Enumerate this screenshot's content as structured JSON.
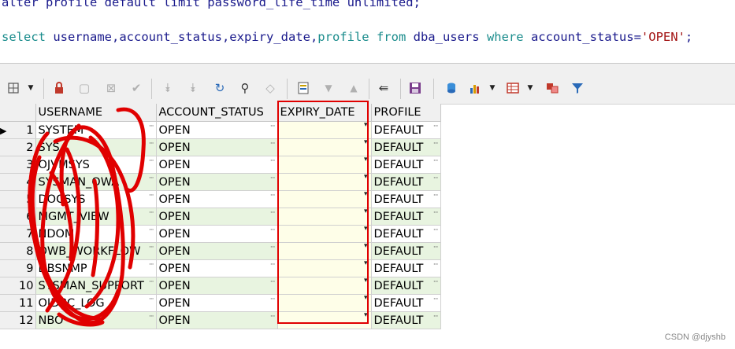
{
  "editor": {
    "line1": "alter profile default limit password_life_time unlimited;",
    "line2_parts": {
      "kw_select": "select",
      "cols": " username,account_status,expiry_date,",
      "kw_profile": "profile",
      "sp1": " ",
      "kw_from": "from",
      "table": " dba_users ",
      "kw_where": "where",
      "cond": " account_status=",
      "str": "'OPEN'",
      "tail": ";"
    }
  },
  "toolbar": {
    "icons": [
      "grid-settings-icon",
      "lock-icon",
      "add-row-icon",
      "delete-row-icon",
      "post-icon",
      "first-page-icon",
      "last-page-icon",
      "refresh-icon",
      "find-icon",
      "clear-icon",
      "single-record-icon",
      "down-arrow-icon",
      "up-arrow-icon",
      "export-link-icon",
      "save-icon",
      "query-icon",
      "chart-icon",
      "table-icon",
      "compare-icon",
      "filter-icon"
    ]
  },
  "grid": {
    "columns": [
      "USERNAME",
      "ACCOUNT_STATUS",
      "EXPIRY_DATE",
      "PROFILE"
    ],
    "rows": [
      {
        "num": "1",
        "username": "SYSTEM",
        "status": "OPEN",
        "expiry": "",
        "profile": "DEFAULT"
      },
      {
        "num": "2",
        "username": "SYS",
        "status": "OPEN",
        "expiry": "",
        "profile": "DEFAULT"
      },
      {
        "num": "3",
        "username": "OJVMSYS",
        "status": "OPEN",
        "expiry": "",
        "profile": "DEFAULT"
      },
      {
        "num": "4",
        "username": "SYSMAN_OWA",
        "status": "OPEN",
        "expiry": "",
        "profile": "DEFAULT"
      },
      {
        "num": "5",
        "username": "DOCSYS",
        "status": "OPEN",
        "expiry": "",
        "profile": "DEFAULT"
      },
      {
        "num": "6",
        "username": "MGMT_VIEW",
        "status": "OPEN",
        "expiry": "",
        "profile": "DEFAULT"
      },
      {
        "num": "7",
        "username": "NDOM",
        "status": "OPEN",
        "expiry": "",
        "profile": "DEFAULT"
      },
      {
        "num": "8",
        "username": "OWB_WORKFLOW",
        "status": "OPEN",
        "expiry": "",
        "profile": "DEFAULT"
      },
      {
        "num": "9",
        "username": "DBSNMP",
        "status": "OPEN",
        "expiry": "",
        "profile": "DEFAULT"
      },
      {
        "num": "10",
        "username": "SYSMAN_SUPPORT",
        "status": "OPEN",
        "expiry": "",
        "profile": "DEFAULT"
      },
      {
        "num": "11",
        "username": "OJDBC_LOG",
        "status": "OPEN",
        "expiry": "",
        "profile": "DEFAULT"
      },
      {
        "num": "12",
        "username": "NBO",
        "status": "OPEN",
        "expiry": "",
        "profile": "DEFAULT"
      }
    ]
  },
  "watermark": "CSDN @djyshb",
  "colors": {
    "annotation_red": "#e00000",
    "row_alt": "#e8f4e0",
    "expiry_bg": "#fefee8"
  }
}
